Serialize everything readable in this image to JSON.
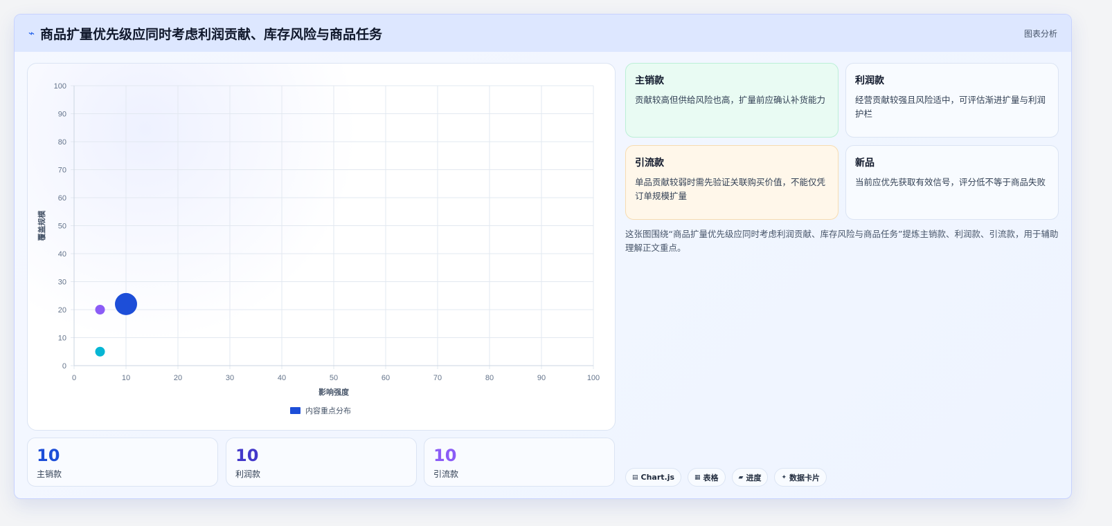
{
  "header": {
    "icon": "bolt-icon",
    "title": "商品扩量优先级应同时考虑利润贡献、库存风险与商品任务",
    "tag": "图表分析"
  },
  "chart_data": {
    "type": "bubble",
    "xlabel": "影响强度",
    "ylabel": "覆盖规模",
    "xlim": [
      0,
      100
    ],
    "ylim": [
      0,
      100
    ],
    "x_ticks": [
      "0",
      "10",
      "20",
      "30",
      "40",
      "50",
      "60",
      "70",
      "80",
      "90",
      "100"
    ],
    "y_ticks": [
      "0",
      "10",
      "20",
      "30",
      "40",
      "50",
      "60",
      "70",
      "80",
      "90",
      "100"
    ],
    "grid": true,
    "legend_position": "bottom",
    "series": [
      {
        "name": "内容重点分布",
        "legend_color": "#1d4ed8",
        "points": [
          {
            "x": 10,
            "y": 22,
            "r": 16,
            "color": "#1d4ed8"
          },
          {
            "x": 5,
            "y": 20,
            "r": 7,
            "color": "#8b5cf6"
          },
          {
            "x": 5,
            "y": 5,
            "r": 7,
            "color": "#06b6d4"
          }
        ]
      }
    ]
  },
  "stats": [
    {
      "value": "10",
      "label": "主销款",
      "color": "#1d4ed8"
    },
    {
      "value": "10",
      "label": "利润款",
      "color": "#4338ca"
    },
    {
      "value": "10",
      "label": "引流款",
      "color": "#8b5cf6"
    }
  ],
  "cards": [
    {
      "title": "主销款",
      "text": "贡献较高但供给风险也高，扩量前应确认补货能力"
    },
    {
      "title": "利润款",
      "text": "经营贡献较强且风险适中，可评估渐进扩量与利润护栏"
    },
    {
      "title": "引流款",
      "text": "单品贡献较弱时需先验证关联购买价值，不能仅凭订单规模扩量"
    },
    {
      "title": "新品",
      "text": "当前应优先获取有效信号，评分低不等于商品失败"
    }
  ],
  "description": "这张图围绕“商品扩量优先级应同时考虑利润贡献、库存风险与商品任务”提炼主销款、利润款、引流款，用于辅助理解正文重点。",
  "chips": [
    {
      "icon": "chart-icon",
      "glyph": "▤",
      "label": "Chart.js"
    },
    {
      "icon": "table-icon",
      "glyph": "▦",
      "label": "表格"
    },
    {
      "icon": "progress-icon",
      "glyph": "▰",
      "label": "进度"
    },
    {
      "icon": "sparkle-icon",
      "glyph": "✦",
      "label": "数据卡片"
    }
  ],
  "colors": {
    "primary": "#1d4ed8",
    "header_bg": "#dde7ff",
    "card_green": "#e9fbf3",
    "card_orange": "#fff7ea"
  }
}
